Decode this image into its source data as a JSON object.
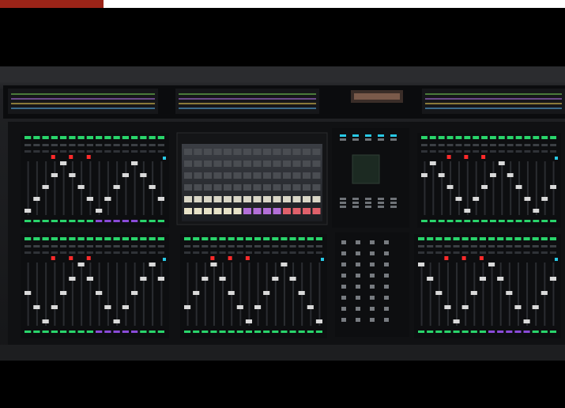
{
  "image": {
    "subject": "digital-mixing-console",
    "colors": {
      "background": "#000000",
      "top_strip": "#ffffff",
      "top_accent": "#9b2418",
      "console_body": "#1b1c1e",
      "panel": "#0d0e10",
      "led_green": "#29d56b",
      "led_red": "#ff2a2a",
      "led_purple": "#8a4bd8",
      "led_cyan": "#28c9e6",
      "fader_cap": "#d9d9d9"
    }
  }
}
